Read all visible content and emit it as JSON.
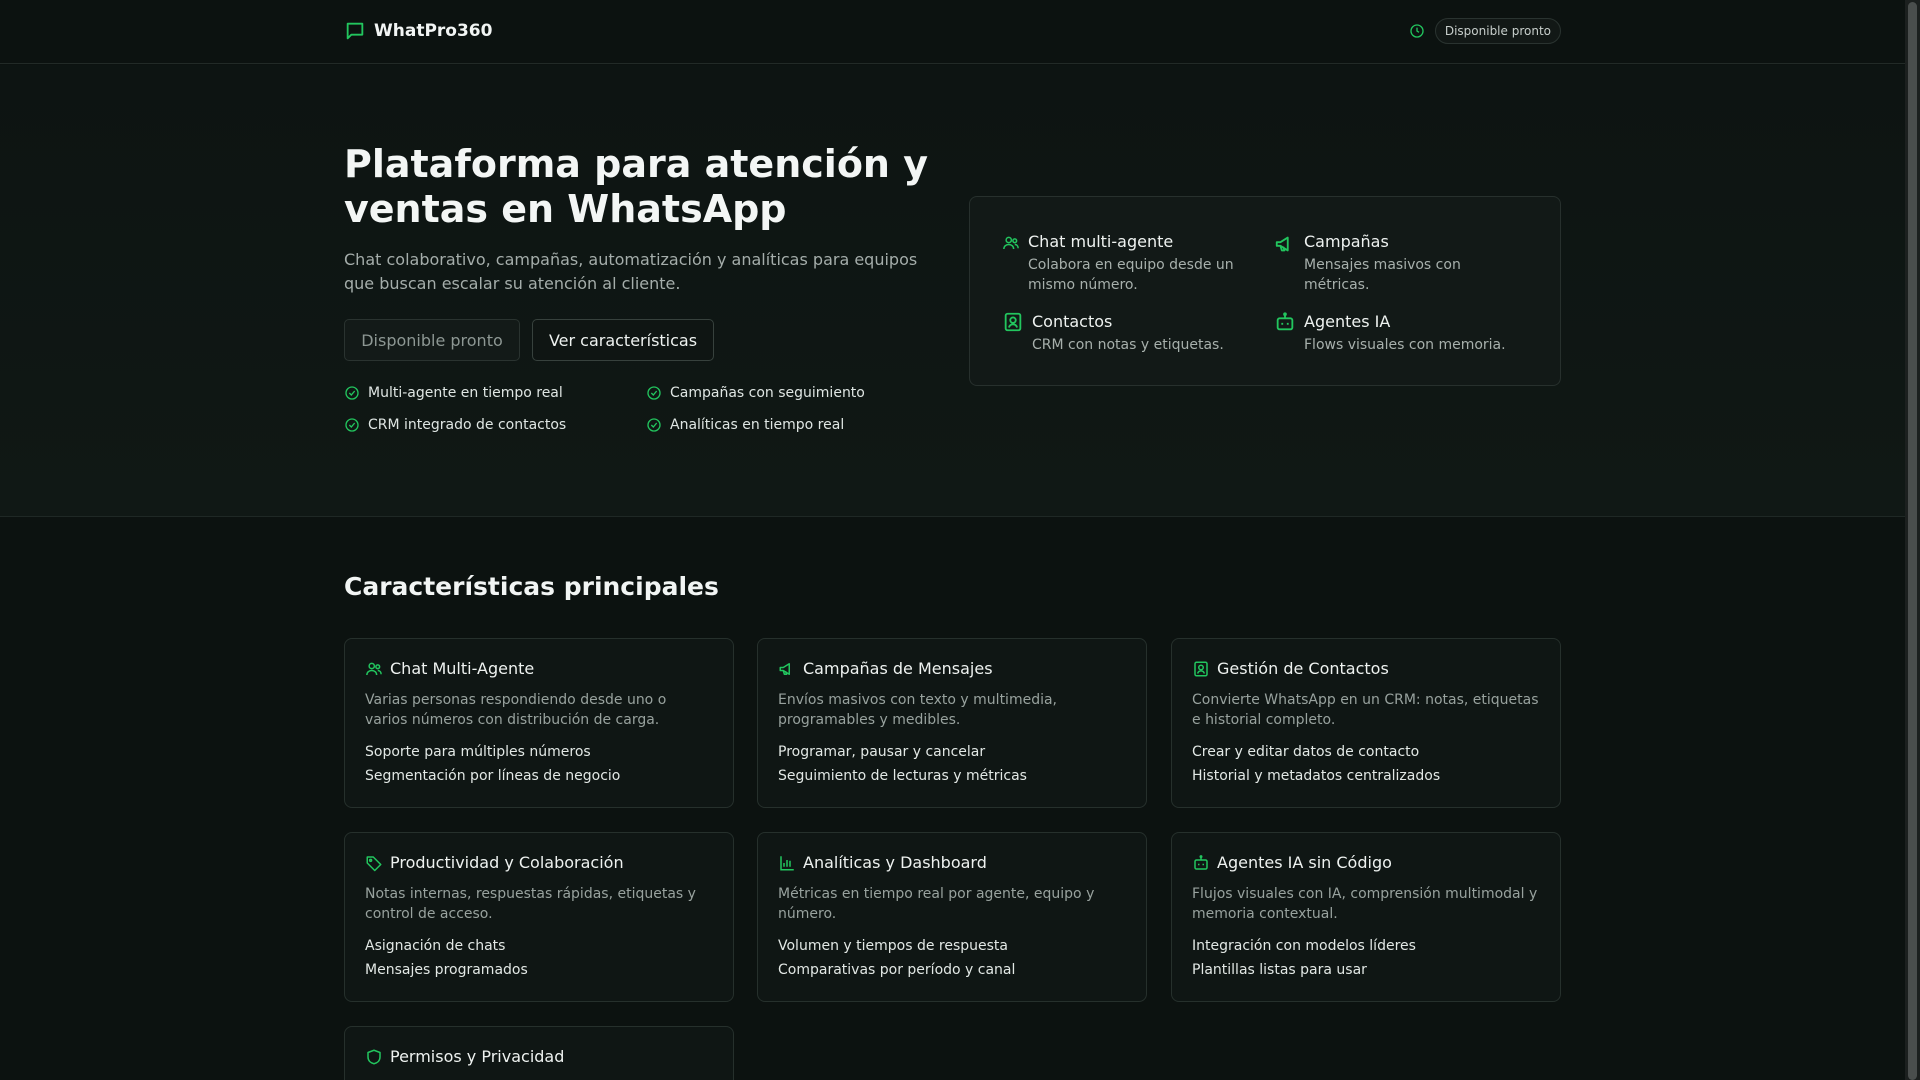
{
  "colors": {
    "accent": "#22c55e",
    "background": "#0c1210",
    "card": "#0f1614",
    "border": "#26302c"
  },
  "header": {
    "brand": "WhatPro360",
    "brand_icon": "chat-bubble-icon",
    "status_icon": "clock-icon",
    "status_label": "Disponible pronto"
  },
  "hero": {
    "title": "Plataforma para atención y ventas en WhatsApp",
    "subtitle": "Chat colaborativo, campañas, automatización y analíticas para equipos que buscan escalar su atención al cliente.",
    "btn_soon": "Disponible pronto",
    "btn_features": "Ver características",
    "checks": [
      "Multi-agente en tiempo real",
      "Campañas con seguimiento",
      "CRM integrado de contactos",
      "Analíticas en tiempo real"
    ],
    "mini": [
      {
        "title": "Chat multi-agente",
        "desc": "Colabora en equipo desde un mismo número.",
        "icon": "users-icon"
      },
      {
        "title": "Campañas",
        "desc": "Mensajes masivos con métricas.",
        "icon": "megaphone-icon"
      },
      {
        "title": "Contactos",
        "desc": "CRM con notas y etiquetas.",
        "icon": "contact-card-icon"
      },
      {
        "title": "Agentes IA",
        "desc": "Flows visuales con memoria.",
        "icon": "bot-icon"
      }
    ]
  },
  "features": {
    "title": "Características principales",
    "cards": [
      {
        "title": "Chat Multi-Agente",
        "icon": "users-icon",
        "desc": "Varias personas respondiendo desde uno o varios números con distribución de carga.",
        "items": [
          "Soporte para múltiples números",
          "Segmentación por líneas de negocio"
        ]
      },
      {
        "title": "Campañas de Mensajes",
        "icon": "megaphone-icon",
        "desc": "Envíos masivos con texto y multimedia, programables y medibles.",
        "items": [
          "Programar, pausar y cancelar",
          "Seguimiento de lecturas y métricas"
        ]
      },
      {
        "title": "Gestión de Contactos",
        "icon": "contact-card-icon",
        "desc": "Convierte WhatsApp en un CRM: notas, etiquetas e historial completo.",
        "items": [
          "Crear y editar datos de contacto",
          "Historial y metadatos centralizados"
        ]
      },
      {
        "title": "Productividad y Colaboración",
        "icon": "tag-icon",
        "desc": "Notas internas, respuestas rápidas, etiquetas y control de acceso.",
        "items": [
          "Asignación de chats",
          "Mensajes programados"
        ]
      },
      {
        "title": "Analíticas y Dashboard",
        "icon": "bar-chart-icon",
        "desc": "Métricas en tiempo real por agente, equipo y número.",
        "items": [
          "Volumen y tiempos de respuesta",
          "Comparativas por período y canal"
        ]
      },
      {
        "title": "Agentes IA sin Código",
        "icon": "bot-icon",
        "desc": "Flujos visuales con IA, comprensión multimodal y memoria contextual.",
        "items": [
          "Integración con modelos líderes",
          "Plantillas listas para usar"
        ]
      },
      {
        "title": "Permisos y Privacidad",
        "icon": "shield-icon",
        "desc": "",
        "items": []
      }
    ]
  }
}
